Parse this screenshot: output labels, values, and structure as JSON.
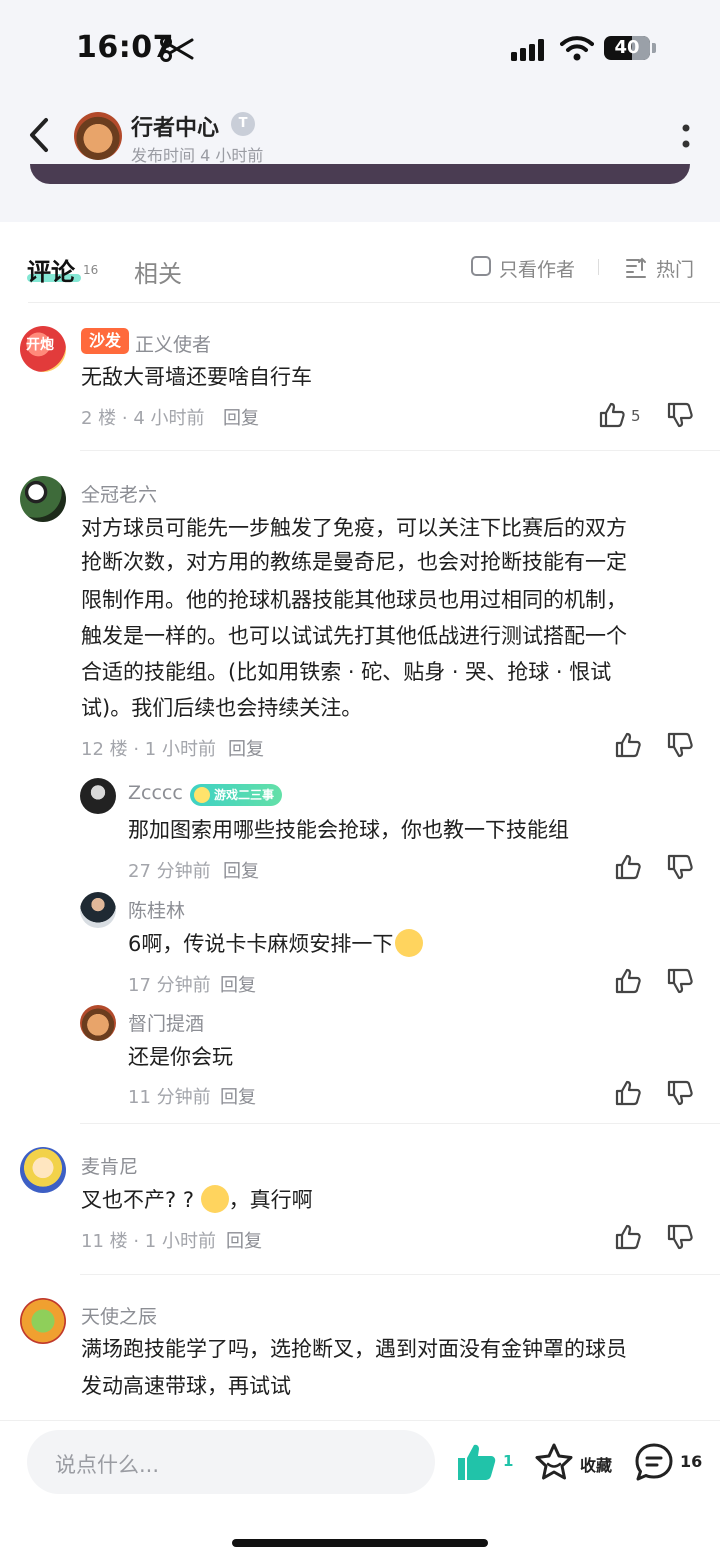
{
  "status_bar": {
    "time": "16:07",
    "battery": "40"
  },
  "header": {
    "author_name": "行者中心",
    "author_badge": "T",
    "publish_time": "发布时间 4 小时前"
  },
  "tabs": {
    "comments_label": "评论",
    "comments_count": "16",
    "related_label": "相关",
    "only_author_label": "只看作者",
    "sort_label": "热门"
  },
  "comments": [
    {
      "avatar_text": "开炮",
      "badge": "沙发",
      "username": "正义使者",
      "text": "无敌大哥墙还要啥自行车",
      "meta": "2 楼 · 4 小时前",
      "reply_label": "回复",
      "likes": "5"
    },
    {
      "username": "全冠老六",
      "text_lines": [
        "对方球员可能先一步触发了免疫，可以关注下比赛后的双方",
        "抢断次数，对方用的教练是曼奇尼，也会对抢断技能有一定",
        "限制作用。他的抢球机器技能其他球员也用过相同的机制，",
        "触发是一样的。也可以试试先打其他低战进行测试搭配一个",
        "合适的技能组。(比如用铁索 · 砣、贴身 · 哭、抢球 · 恨试",
        "试)。我们后续也会持续关注。"
      ],
      "meta": "12 楼 · 1 小时前",
      "reply_label": "回复",
      "replies": [
        {
          "username": "Zcccc",
          "badge": "游戏二三事",
          "text": "那加图索用哪些技能会抢球，你也教一下技能组",
          "meta": "27 分钟前",
          "reply_label": "回复"
        },
        {
          "username": "陈桂林",
          "text": "6啊，传说卡卡麻烦安排一下",
          "meta": "17 分钟前",
          "reply_label": "回复"
        },
        {
          "username": "督门提酒",
          "text": "还是你会玩",
          "meta": "11 分钟前",
          "reply_label": "回复"
        }
      ]
    },
    {
      "username": "麦肯尼",
      "text_before": "叉也不产? ? ",
      "text_after": "，真行啊",
      "meta": "11 楼 · 1 小时前",
      "reply_label": "回复"
    },
    {
      "username": "天使之辰",
      "text_lines": [
        "满场跑技能学了吗，选抢断叉，遇到对面没有金钟罩的球员",
        "发动高速带球，再试试"
      ]
    }
  ],
  "bottom_bar": {
    "input_placeholder": "说点什么...",
    "like_count": "1",
    "favorite_label": "收藏",
    "comment_count": "16"
  },
  "colors": {
    "accent": "#21c3a9",
    "sofa_badge": "#ff6a3c",
    "header_bar": "#4a3c52"
  }
}
